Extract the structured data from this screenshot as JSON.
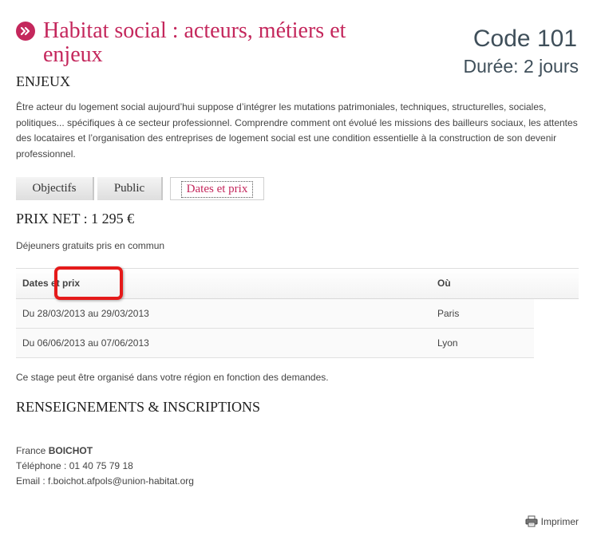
{
  "header": {
    "title": "Habitat social : acteurs, métiers et enjeux",
    "code": "Code 101",
    "duree": "Durée: 2 jours"
  },
  "enjeux": {
    "heading": "ENJEUX",
    "text": "Être acteur du logement social aujourd’hui suppose d’intégrer les mutations patrimoniales, techniques, structurelles, sociales, politiques... spécifiques à ce secteur professionnel. Comprendre comment ont évolué les missions des bailleurs sociaux, les attentes des locataires et l’organisation des entreprises de logement social est une condition essentielle à la construction de son devenir professionnel."
  },
  "tabs": [
    {
      "label": "Objectifs"
    },
    {
      "label": "Public"
    },
    {
      "label": "Dates et prix",
      "active": true
    }
  ],
  "pricing": {
    "prix": "PRIX NET : 1 295 €",
    "dejeuners": "Déjeuners gratuits pris en commun"
  },
  "sessions_table": {
    "headers": [
      "Dates et prix",
      "Où"
    ],
    "rows": [
      {
        "dates": "Du 28/03/2013 au 29/03/2013",
        "lieu": "Paris"
      },
      {
        "dates": "Du 06/06/2013 au 07/06/2013",
        "lieu": "Lyon"
      }
    ]
  },
  "stage_note": "Ce stage peut être organisé dans votre région en fonction des demandes.",
  "renseignements": {
    "heading": "RENSEIGNEMENTS & INSCRIPTIONS",
    "first_name": "France ",
    "last_name": "BOICHOT",
    "phone": "Téléphone :  01 40 75 79 18",
    "email": "Email : f.boichot.afpols@union-habitat.org"
  },
  "actions": {
    "print_label": "Imprimer"
  },
  "colors": {
    "accent": "#c4275c",
    "code_text": "#3f4f5a",
    "highlight": "#e51a1a"
  },
  "icons": {
    "title_arrow": "arrow-circle-icon",
    "print": "printer-icon"
  }
}
